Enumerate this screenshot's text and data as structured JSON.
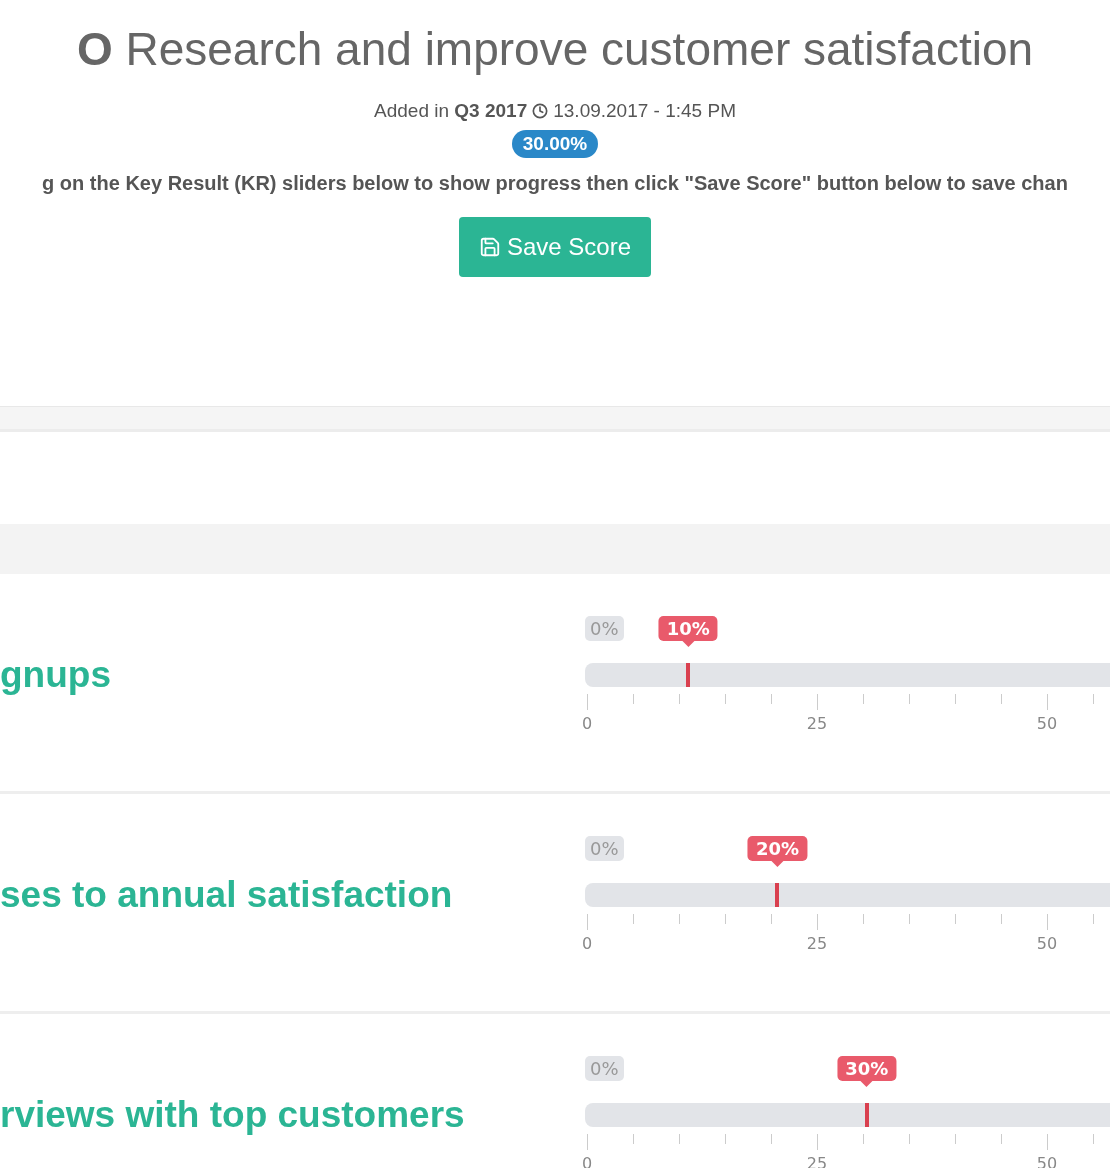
{
  "objective": {
    "title": "**O** Research and improve customer satisfaction",
    "added_in": "Added in **Q3 2017**",
    "timestamp": "13.09.2017 - 1:45 PM",
    "score": "30.00%"
  },
  "instruction": "g on the Key Result (KR) sliders below to show progress then click \"Save Score\" button below to save chan",
  "save_button": {
    "label": "Save Score"
  },
  "key_results": [
    {
      "title": "gnups",
      "min_label": "0%",
      "value_label": "10%",
      "level": 0.11,
      "scale_labels": [
        "0",
        "25",
        "50"
      ]
    },
    {
      "title": "ses to annual satisfaction",
      "min_label": "0%",
      "value_label": "20%",
      "level": 0.207,
      "scale_labels": [
        "0",
        "25",
        "50"
      ]
    },
    {
      "title": "rviews with top customers",
      "min_label": "0%",
      "value_label": "30%",
      "level": 0.304,
      "scale_labels": [
        "0",
        "25",
        "50"
      ]
    }
  ]
}
